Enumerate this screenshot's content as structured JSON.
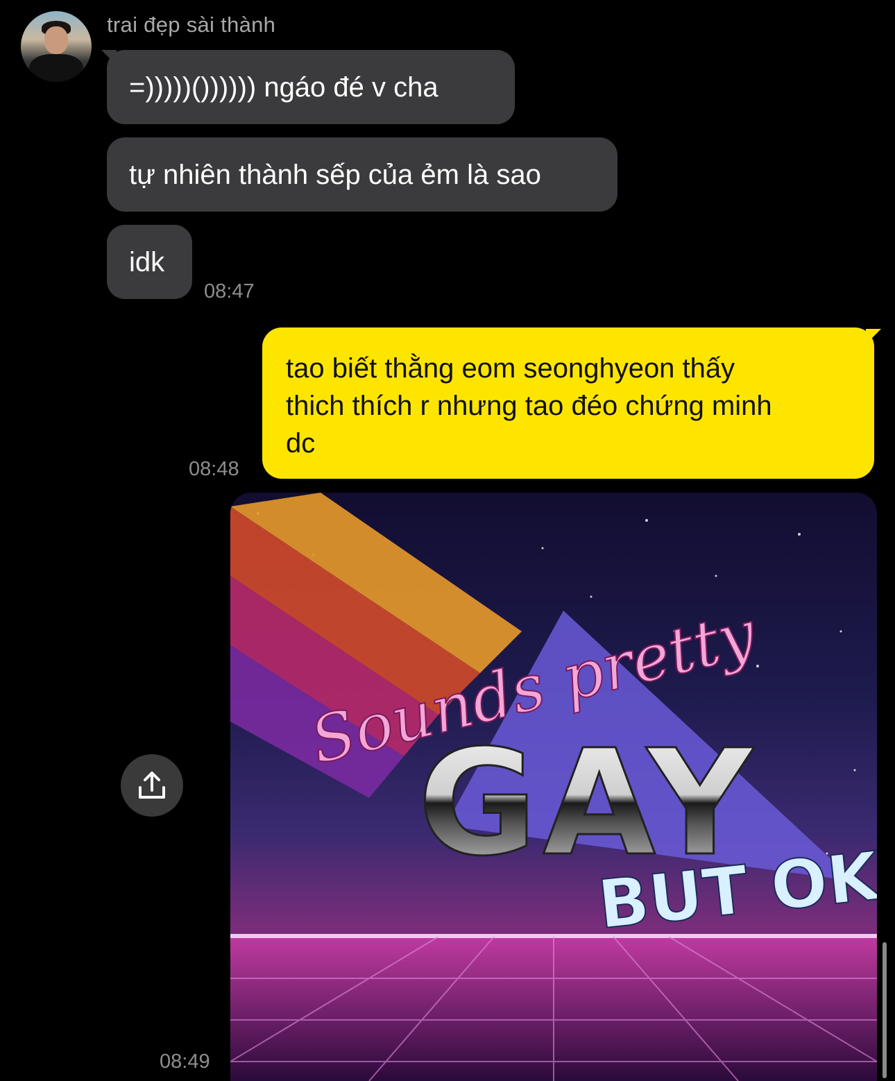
{
  "conversation": {
    "sender_name": "trai đẹp sài thành",
    "incoming": [
      {
        "text": "=)))))()))))) ngáo đé v cha"
      },
      {
        "text": "tự nhiên thành sếp của ẻm là sao"
      },
      {
        "text": "idk"
      }
    ],
    "incoming_time": "08:47",
    "outgoing": {
      "lines": [
        "tao biết thằng eom seonghyeon thấy",
        "thich thích r nhưng tao đéo chứng minh",
        "dc"
      ],
      "time": "08:48"
    },
    "image_message": {
      "meme_line1": "Sounds pretty",
      "meme_line2": "GAY",
      "meme_line3": "BUT OK",
      "time": "08:49"
    }
  },
  "icons": {
    "share": "share-upload-icon"
  },
  "colors": {
    "background": "#000000",
    "incoming_bubble": "#3b3b3d",
    "outgoing_bubble": "#fee500"
  }
}
